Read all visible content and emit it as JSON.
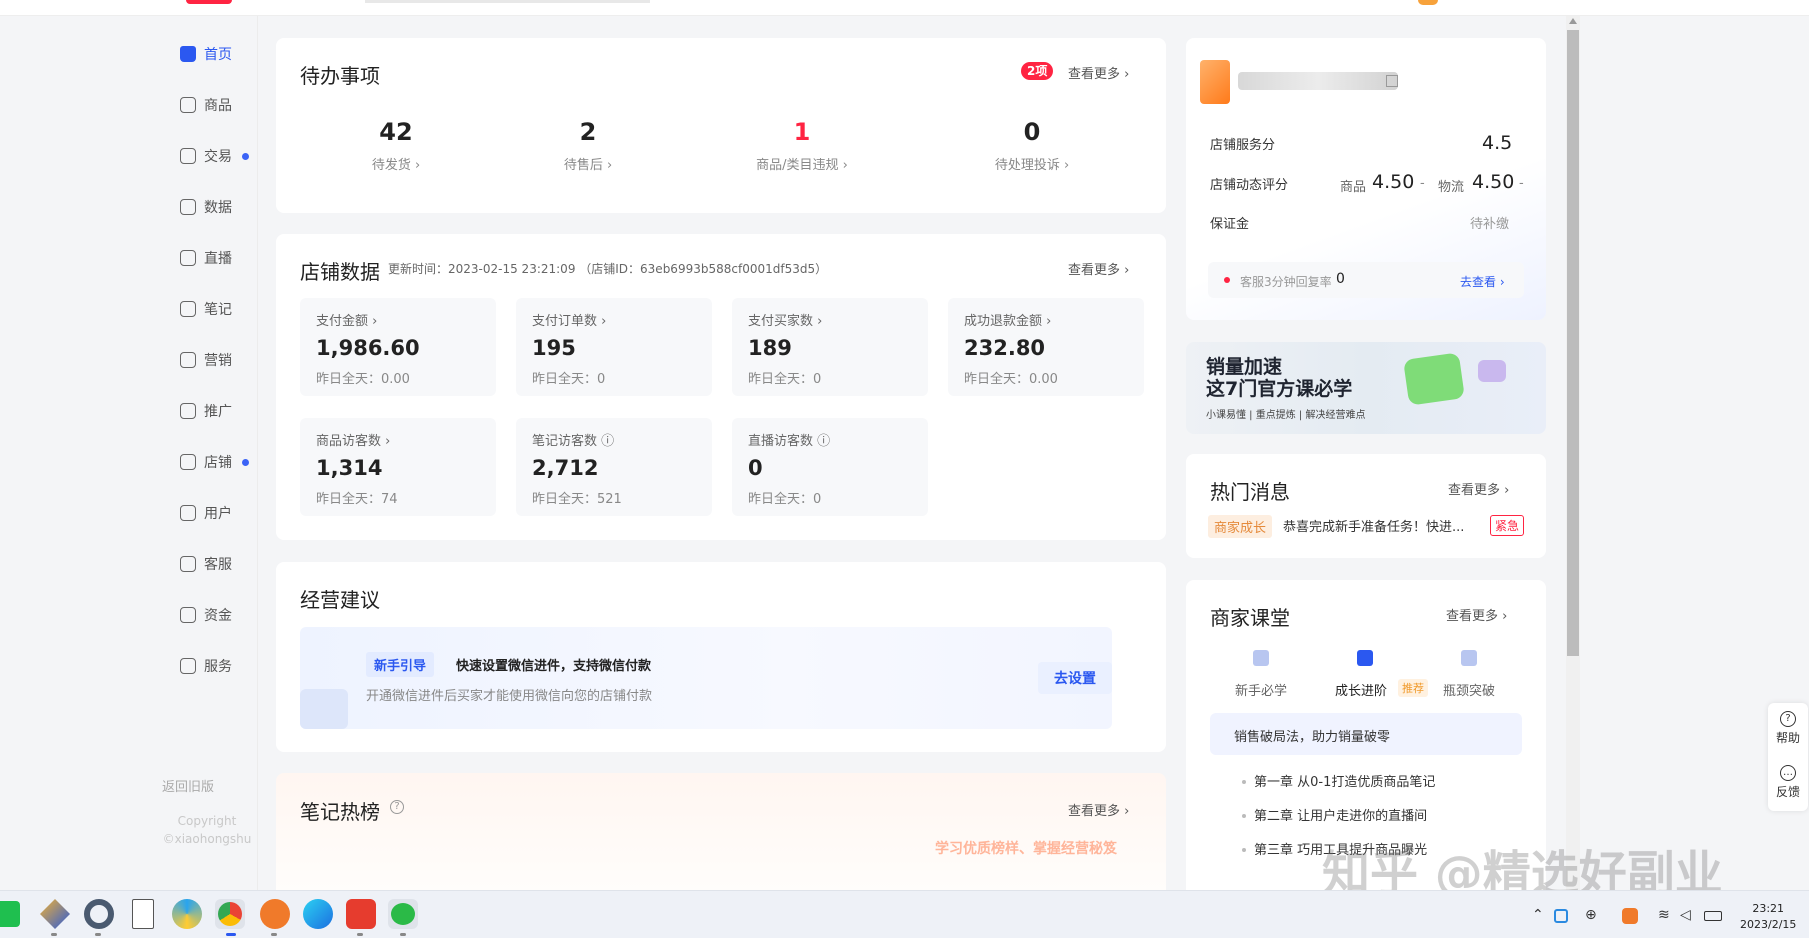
{
  "sidebar": {
    "items": [
      {
        "label": "首页",
        "active": true,
        "dot": false,
        "icon": "home-icon"
      },
      {
        "label": "商品",
        "active": false,
        "dot": false,
        "icon": "product-icon"
      },
      {
        "label": "交易",
        "active": false,
        "dot": true,
        "icon": "trade-icon"
      },
      {
        "label": "数据",
        "active": false,
        "dot": false,
        "icon": "chart-icon"
      },
      {
        "label": "直播",
        "active": false,
        "dot": false,
        "icon": "live-icon"
      },
      {
        "label": "笔记",
        "active": false,
        "dot": false,
        "icon": "book-icon"
      },
      {
        "label": "营销",
        "active": false,
        "dot": false,
        "icon": "megaphone-icon"
      },
      {
        "label": "推广",
        "active": false,
        "dot": false,
        "icon": "promote-icon"
      },
      {
        "label": "店铺",
        "active": false,
        "dot": true,
        "icon": "store-icon"
      },
      {
        "label": "用户",
        "active": false,
        "dot": false,
        "icon": "users-icon"
      },
      {
        "label": "客服",
        "active": false,
        "dot": false,
        "icon": "chat-icon"
      },
      {
        "label": "资金",
        "active": false,
        "dot": false,
        "icon": "wallet-icon"
      },
      {
        "label": "服务",
        "active": false,
        "dot": false,
        "icon": "service-icon"
      }
    ],
    "back_label": "返回旧版",
    "copyright_1": "Copyright",
    "copyright_2": "©xiaohongshu"
  },
  "todo": {
    "title": "待办事项",
    "badge": "2项",
    "more": "查看更多 ›",
    "items": [
      {
        "value": "42",
        "label": "待发货 ›",
        "red": false
      },
      {
        "value": "2",
        "label": "待售后 ›",
        "red": false
      },
      {
        "value": "1",
        "label": "商品/类目违规 ›",
        "red": true
      },
      {
        "value": "0",
        "label": "待处理投诉 ›",
        "red": false
      }
    ]
  },
  "store_data": {
    "title": "店铺数据",
    "update": "更新时间：2023-02-15 23:21:09 （店铺ID：63eb6993b588cf0001df53d5）",
    "more": "查看更多 ›",
    "metrics": [
      {
        "label": "支付金额 ›",
        "value": "1,986.60",
        "yday": "昨日全天：0.00"
      },
      {
        "label": "支付订单数 ›",
        "value": "195",
        "yday": "昨日全天：0"
      },
      {
        "label": "支付买家数 ›",
        "value": "189",
        "yday": "昨日全天：0"
      },
      {
        "label": "成功退款金额 ›",
        "value": "232.80",
        "yday": "昨日全天：0.00"
      },
      {
        "label": "商品访客数 ›",
        "value": "1,314",
        "yday": "昨日全天：74"
      },
      {
        "label": "笔记访客数 ⓘ",
        "value": "2,712",
        "yday": "昨日全天：521"
      },
      {
        "label": "直播访客数 ⓘ",
        "value": "0",
        "yday": "昨日全天：0"
      }
    ]
  },
  "advice": {
    "title": "经营建议",
    "tag": "新手引导",
    "headline": "快速设置微信进件，支持微信付款",
    "desc": "开通微信进件后买家才能使用微信向您的店铺付款",
    "button": "去设置"
  },
  "notes": {
    "title": "笔记热榜",
    "help": "?",
    "more": "查看更多 ›",
    "slogan": "学习优质榜样、掌握经营秘笈"
  },
  "shop": {
    "score_label": "店铺服务分",
    "score_value": "4.5",
    "dynamic_label": "店铺动态评分",
    "goods_label": "商品",
    "goods_value": "4.50",
    "goods_trend": "-",
    "logistics_label": "物流",
    "logistics_value": "4.50",
    "logistics_trend": "-",
    "deposit_label": "保证金",
    "deposit_value": "待补缴",
    "reply_label": "客服3分钟回复率",
    "reply_value": "0",
    "reply_link": "去查看 ›"
  },
  "promo": {
    "line1": "销量加速",
    "line2": "这7门官方课必学",
    "sub": "小课易懂 | 重点提炼 | 解决经营难点"
  },
  "hot_news": {
    "title": "热门消息",
    "more": "查看更多 ›",
    "tag": "商家成长",
    "text": "恭喜完成新手准备任务！快进...",
    "urgent": "紧急"
  },
  "course": {
    "title": "商家课堂",
    "more": "查看更多 ›",
    "tabs": [
      "新手必学",
      "成长进阶",
      "瓶颈突破"
    ],
    "recommend": "推荐",
    "head": "销售破局法，助力销量破零",
    "chapters": [
      "第一章 从0-1打造优质商品笔记",
      "第二章 让用户走进你的直播间",
      "第三章 巧用工具提升商品曝光"
    ]
  },
  "float": {
    "help": "帮助",
    "feedback": "反馈"
  },
  "watermark": "知乎 @精选好副业",
  "clock": {
    "time": "23:21",
    "date": "2023/2/15"
  },
  "colors": {
    "accent": "#2b58f0",
    "brand_red": "#ff2442"
  }
}
